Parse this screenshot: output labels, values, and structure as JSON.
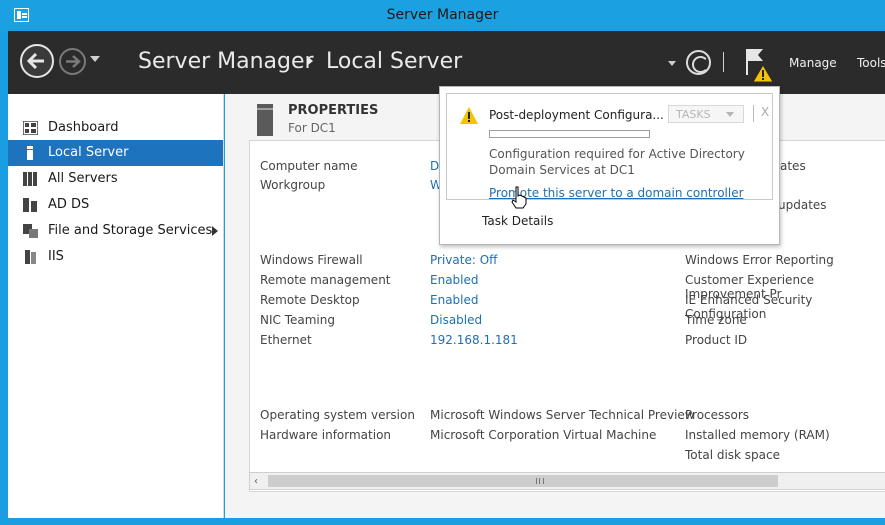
{
  "window": {
    "title": "Server Manager"
  },
  "header": {
    "breadcrumb_root": "Server Manager",
    "breadcrumb_page": "Local Server",
    "menu_manage": "Manage",
    "menu_tools": "Tools"
  },
  "sidebar": {
    "items": [
      {
        "label": "Dashboard",
        "icon": "dashboard-icon"
      },
      {
        "label": "Local Server",
        "icon": "local-server-icon",
        "active": true
      },
      {
        "label": "All Servers",
        "icon": "all-servers-icon"
      },
      {
        "label": "AD DS",
        "icon": "ad-ds-icon"
      },
      {
        "label": "File and Storage Services",
        "icon": "file-storage-icon",
        "expandable": true
      },
      {
        "label": "IIS",
        "icon": "iis-icon"
      }
    ]
  },
  "properties": {
    "title": "PROPERTIES",
    "subtitle": "For DC1",
    "rows": {
      "computer_name_label": "Computer name",
      "computer_name_value": "D",
      "workgroup_label": "Workgroup",
      "workgroup_value": "W",
      "firewall_label": "Windows Firewall",
      "firewall_value": "Private: Off",
      "remote_mgmt_label": "Remote management",
      "remote_mgmt_value": "Enabled",
      "remote_desktop_label": "Remote Desktop",
      "remote_desktop_value": "Enabled",
      "nic_label": "NIC Teaming",
      "nic_value": "Disabled",
      "ethernet_label": "Ethernet",
      "ethernet_value": "192.168.1.181",
      "os_label": "Operating system version",
      "os_value": "Microsoft Windows Server Technical Preview",
      "hw_label": "Hardware information",
      "hw_value": "Microsoft Corporation Virtual Machine"
    },
    "right_column": {
      "updates_partial": "ates",
      "updates_partial2": "updates",
      "error_reporting": "Windows Error Reporting",
      "ceip": "Customer Experience Improvement Pr",
      "ie_esc": "IE Enhanced Security Configuration",
      "time_zone": "Time zone",
      "product_id": "Product ID",
      "processors": "Processors",
      "memory": "Installed memory (RAM)",
      "disk": "Total disk space"
    }
  },
  "notification": {
    "title": "Post-deployment Configura...",
    "tasks_label": "TASKS",
    "close_label": "X",
    "progress": 0,
    "description": "Configuration required for Active Directory Domain Services at DC1",
    "link": "Promote this server to a domain controller",
    "task_details": "Task Details"
  },
  "colors": {
    "accent": "#1ba1e2",
    "selected": "#1e73be",
    "link": "#1e6fb5",
    "header_bg": "#2b2b2b"
  }
}
